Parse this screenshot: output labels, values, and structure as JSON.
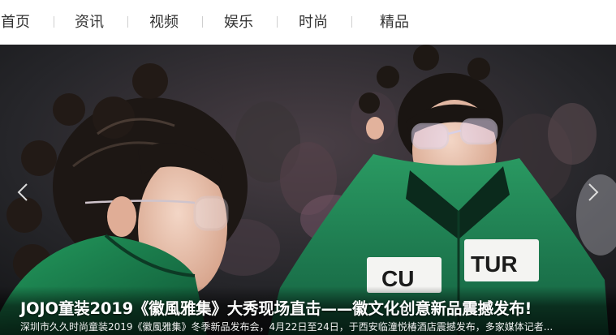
{
  "nav": {
    "items": [
      "首页",
      "资讯",
      "视频",
      "娱乐",
      "时尚",
      "精品"
    ]
  },
  "slide": {
    "headline": "JOJO童装2019《徽風雅集》大秀现场直击——徽文化创意新品震撼发布!",
    "summary": "深圳市久久时尚童装2019《徽風雅集》冬季新品发布会，4月22日至24日，于西安临潼悦椿酒店震撼发布，多家媒体记者...",
    "shirt_text_left": "CU",
    "shirt_text_right": "TUR",
    "prev_icon": "chevron-left-icon",
    "next_icon": "chevron-right-icon"
  },
  "colors": {
    "nav_text": "#333333",
    "nav_separator": "#cfcfcf",
    "jacket_green": "#1f7a4e",
    "caption_text": "#ffffff"
  }
}
